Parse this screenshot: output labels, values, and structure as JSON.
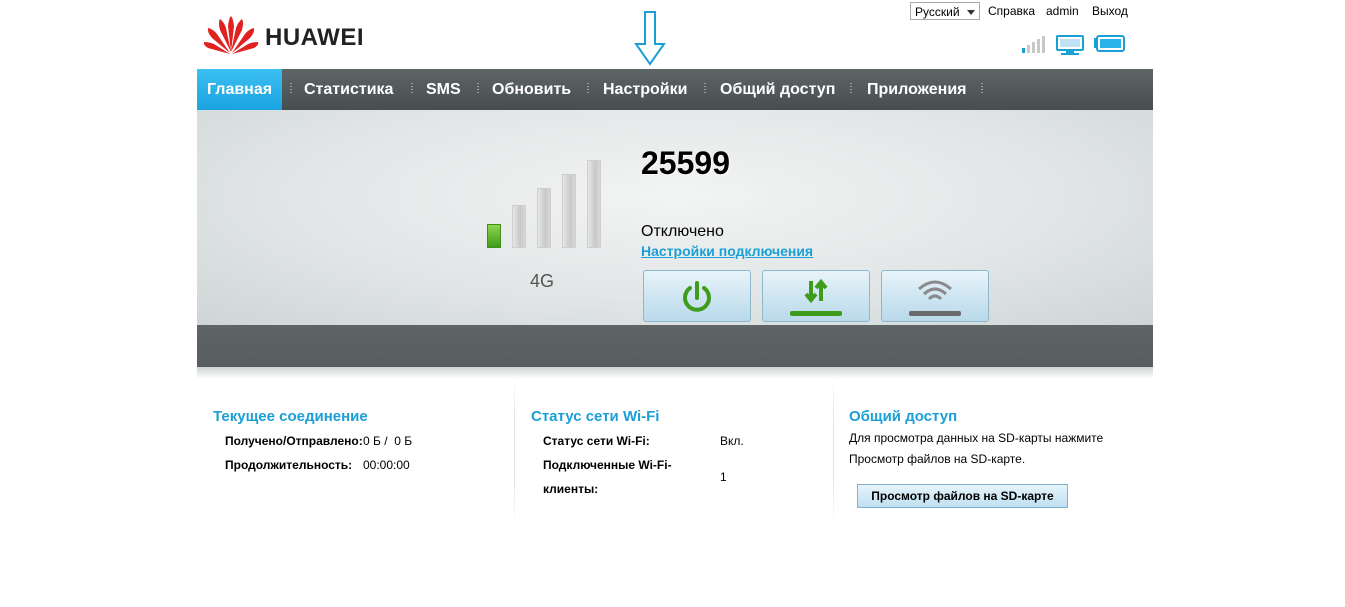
{
  "header": {
    "brand": "HUAWEI",
    "language": "Русский",
    "links": {
      "help": "Справка",
      "user": "admin",
      "logout": "Выход"
    }
  },
  "nav": {
    "items": [
      {
        "label": "Главная",
        "active": true
      },
      {
        "label": "Статистика"
      },
      {
        "label": "SMS"
      },
      {
        "label": "Обновить"
      },
      {
        "label": "Настройки"
      },
      {
        "label": "Общий доступ"
      },
      {
        "label": "Приложения"
      }
    ]
  },
  "signal": {
    "bars_total": 5,
    "bars_on": 1,
    "network_type": "4G"
  },
  "connection": {
    "operator": "25599",
    "status": "Отключено",
    "settings_link": "Настройки подключения"
  },
  "buttons": [
    {
      "icon": "power-icon"
    },
    {
      "icon": "data-transfer-icon"
    },
    {
      "icon": "wifi-icon"
    }
  ],
  "current_connection": {
    "title": "Текущее соединение",
    "received_sent_label": "Получено/Отправлено:",
    "received_sent_value": "0 Б /  0 Б",
    "duration_label": "Продолжительность:",
    "duration_value": "00:00:00"
  },
  "wifi_status": {
    "title": "Статус сети Wi-Fi",
    "status_label": "Статус сети Wi-Fi:",
    "status_value": "Вкл.",
    "clients_label_line1": "Подключенные Wi-Fi-",
    "clients_label_line2": "клиенты:",
    "clients_value": "1"
  },
  "sharing": {
    "title": "Общий доступ",
    "text_line1": "Для просмотра данных на SD-карты нажмите",
    "text_line2": "Просмотр файлов на SD-карте.",
    "button_label": "Просмотр файлов на SD-карте"
  },
  "colors": {
    "accent": "#1a9fd6",
    "nav_bg": "#4f5758",
    "active_tab": "#2bb3ec",
    "signal_on": "#4aa82a"
  }
}
